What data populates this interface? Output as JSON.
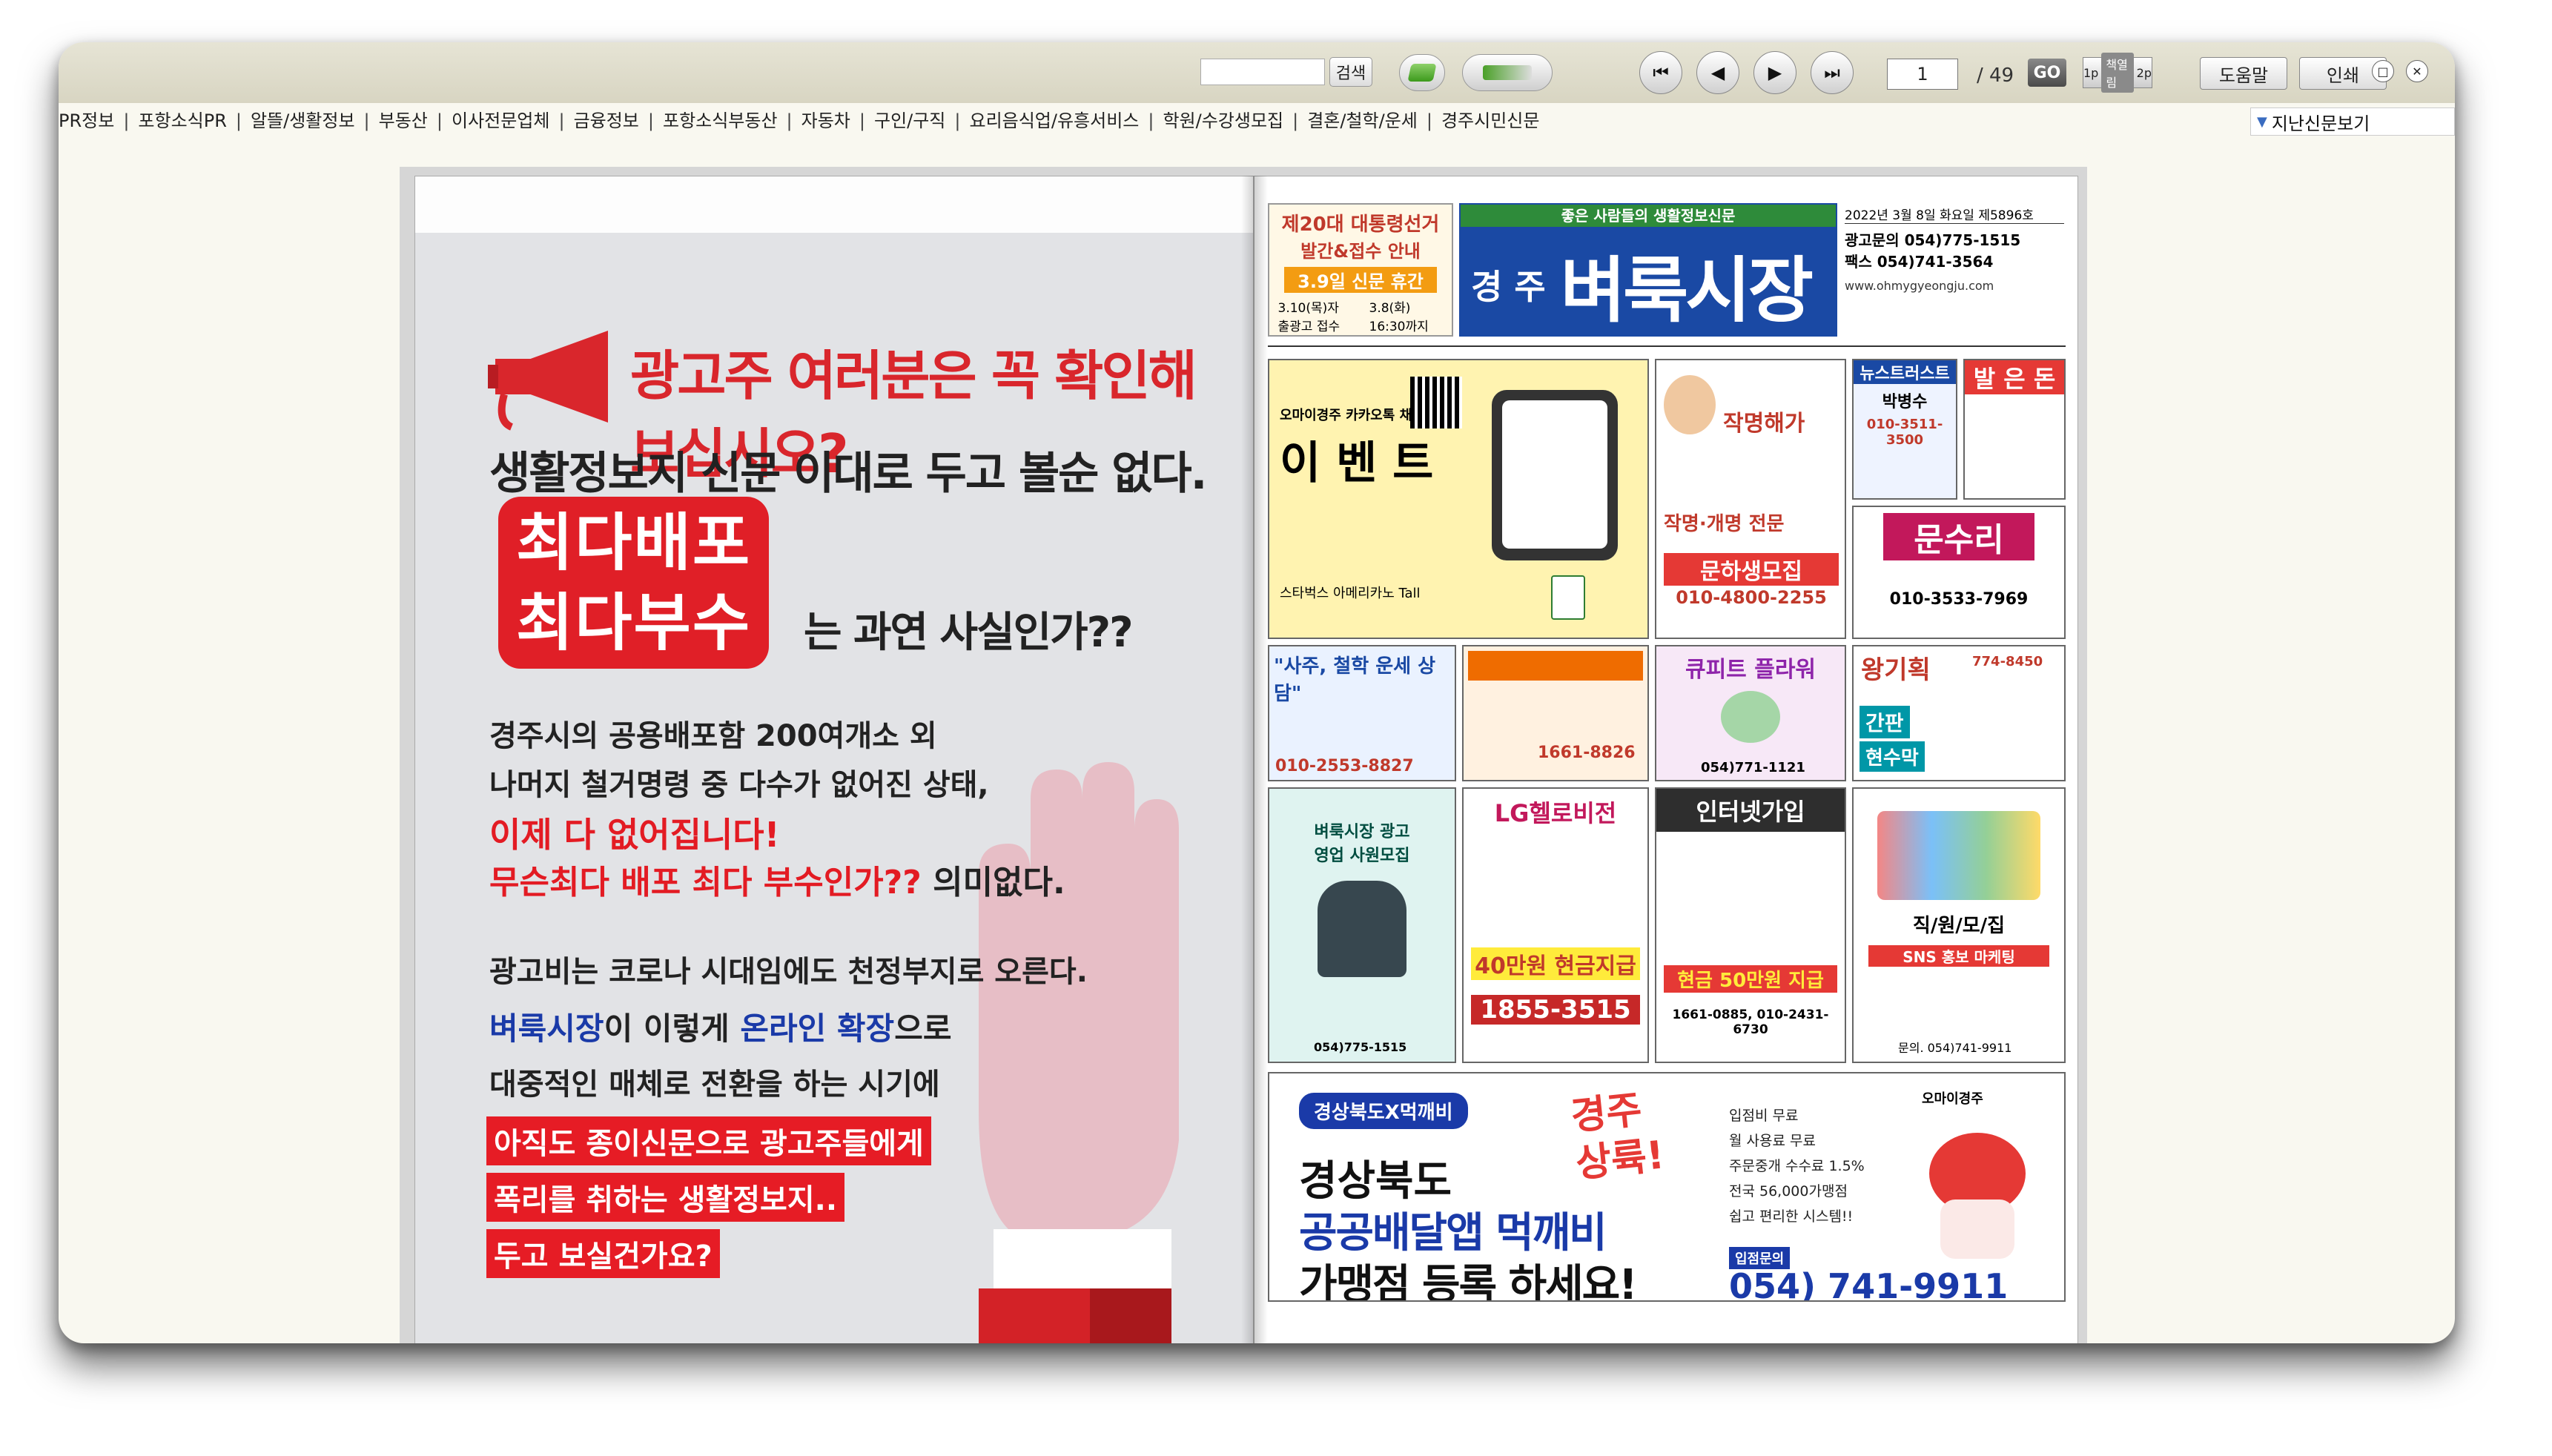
{
  "toolbar": {
    "search_label": "검색",
    "first_icon": "⏮",
    "prev_icon": "◀",
    "next_icon": "▶",
    "last_icon": "⏭",
    "page_value": "1",
    "page_total": "/ 49",
    "go_label": "GO",
    "toggle_left": "1p",
    "toggle_mid": "책열림",
    "toggle_right": "2p",
    "help_label": "도움말",
    "print_label": "인쇄",
    "maximize_icon": "□",
    "close_icon": "✕"
  },
  "menu": [
    "PR정보",
    "포항소식PR",
    "알뜰/생활정보",
    "부동산",
    "이사전문업체",
    "금융정보",
    "포항소식부동산",
    "자동차",
    "구인/구직",
    "요리음식업/유흥서비스",
    "학원/수강생모집",
    "결혼/철학/운세",
    "경주시민신문"
  ],
  "back_issue": "지난신문보기",
  "left_page": {
    "headline": "광고주 여러분은 꼭 확인해 보십시오?",
    "subhead": "생활정보지 신문 이대로 두고 볼순 없다.",
    "red_box_1": "최다배포",
    "red_box_2": "최다부수",
    "question": "는 과연 사실인가??",
    "p1": "경주시의 공용배포함 200여개소 외",
    "p2": "나머지 철거명령 중 다수가 없어진 상태,",
    "p3_red": "이제 다 없어집니다!",
    "p4_red": "무슨최다 배포 최다 부수인가??",
    "p4_tail": " 의미없다.",
    "p5": "광고비는 코로나 시대임에도 천정부지로 오른다.",
    "p6_a": "벼룩시장",
    "p6_b": "이 이렇게 ",
    "p6_c": "온라인 확장",
    "p6_d": "으로",
    "p7": "대중적인 매체로 전환을 하는 시기에",
    "label1": "아직도 종이신문으로 광고주들에게",
    "label2": "폭리를 취하는 생활정보지..",
    "label3": "두고 보실건가요?"
  },
  "right_page": {
    "election_title": "제20대 대통령선거",
    "election_sub": "발간&접수 안내",
    "election_banner": "3.9일 신문 휴간",
    "election_d1": "3.10(목)자 출광고 접수",
    "election_d2": "3.8(화) 16:30까지",
    "masthead_tag": "좋은 사람들의 생활정보신문",
    "masthead_city": "경 주",
    "masthead_title": "벼룩시장",
    "date_line": "2022년 3월 8일 화요일 제5896호",
    "ad_phone": "광고문의 054)775-1515",
    "fax_phone": "팩스 054)741-3564",
    "url": "www.ohmygyeongju.com",
    "event_title": "이 벤 트",
    "event_sub": "오마이경주 카카오톡 채널",
    "event_prize": "스타벅스 아메리카노 Tall",
    "ad_naming_title": "작명해가",
    "ad_naming_2": "작명·개명 전문",
    "ad_recruit": "문하생모집",
    "ad_recruit_phone": "010-4800-2255",
    "ad_newstrust": "뉴스트러스트",
    "ad_newstrust_name": "박병수",
    "ad_newstrust_phone": "010-3511-3500",
    "ad_baleun": "발 은 돈",
    "ad_munsuri": "문수리",
    "ad_munsuri_phone": "010-3533-7969",
    "ad_saju": "\"사주, 철학 운세 상담\"",
    "ad_saju_phone": "010-2553-8827",
    "ad_realty_phone": "1661-8826",
    "ad_cupid": "큐피트 플라워",
    "ad_cupid_phone": "054)771-1121",
    "ad_sign": "왕기획",
    "ad_sign_phone": "774-8450",
    "ad_sign_b1": "간판",
    "ad_sign_b2": "현수막",
    "ad_staff": "벼룩시장 광고영업 사원모집",
    "ad_staff_phone": "054)775-1515",
    "ad_lg": "LG헬로비전",
    "ad_lg_deal": "40만원 현금지급",
    "ad_lg_phone": "1855-3515",
    "ad_net": "인터넷가입",
    "ad_net_deal": "현금 50만원 지급",
    "ad_net_phone": "1661-0885, 010-2431-6730",
    "ad_sns_title": "직/원/모/집",
    "ad_sns": "SNS 홍보 마케팅",
    "ad_sns_phone": "문의. 054)741-9911",
    "bottom_tag": "경상북도X먹깨비",
    "bottom_l1": "경상북도",
    "bottom_l2": "공공배달앱 먹깨비",
    "bottom_l3": "가맹점 등록 하세요!",
    "bottom_hot": "경주 상륙!",
    "bottom_b1": "입점비 무료",
    "bottom_b2": "월 사용료 무료",
    "bottom_b3": "주문중개 수수료 1.5%",
    "bottom_b4": "전국 56,000가맹점",
    "bottom_b5": "쉽고 편리한 시스템!!",
    "bottom_inquiry": "입점문의",
    "bottom_phone": "054) 741-9911",
    "bottom_logo": "오마이경주"
  },
  "colors": {
    "accent_red": "#e01f27",
    "masthead_blue": "#1a49a4",
    "toolbar_bg": "#dedcc9"
  }
}
